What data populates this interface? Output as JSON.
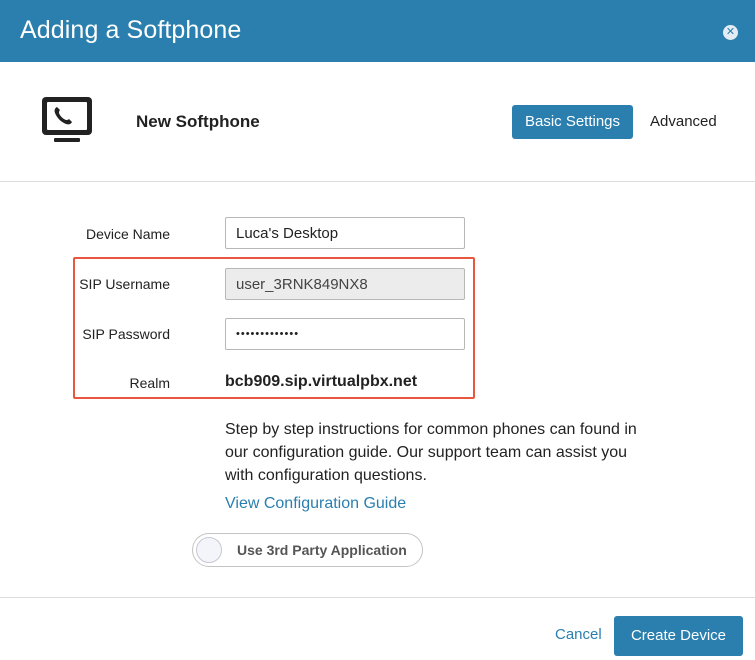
{
  "dialog": {
    "title": "Adding a Softphone",
    "close_icon": "close-icon"
  },
  "device": {
    "icon": "softphone-monitor-icon",
    "name": "New Softphone"
  },
  "tabs": {
    "basic_label": "Basic Settings",
    "advanced_label": "Advanced",
    "active": "Basic Settings"
  },
  "form": {
    "device_name": {
      "label": "Device Name",
      "value": "Luca's Desktop"
    },
    "sip_username": {
      "label": "SIP Username",
      "value": "user_3RNK849NX8"
    },
    "sip_password": {
      "label": "SIP Password",
      "value": "•••••••••••••"
    },
    "realm": {
      "label": "Realm",
      "value": "bcb909.sip.virtualpbx.net"
    }
  },
  "help": {
    "text": "Step by step instructions for common phones can found in our configuration guide. Our support team can assist you with configuration questions.",
    "link_label": "View Configuration Guide"
  },
  "toggle": {
    "label": "Use 3rd Party Application",
    "enabled": false
  },
  "footer": {
    "cancel_label": "Cancel",
    "create_label": "Create Device"
  },
  "colors": {
    "brand": "#2a7fae",
    "highlight": "#e8573f"
  }
}
